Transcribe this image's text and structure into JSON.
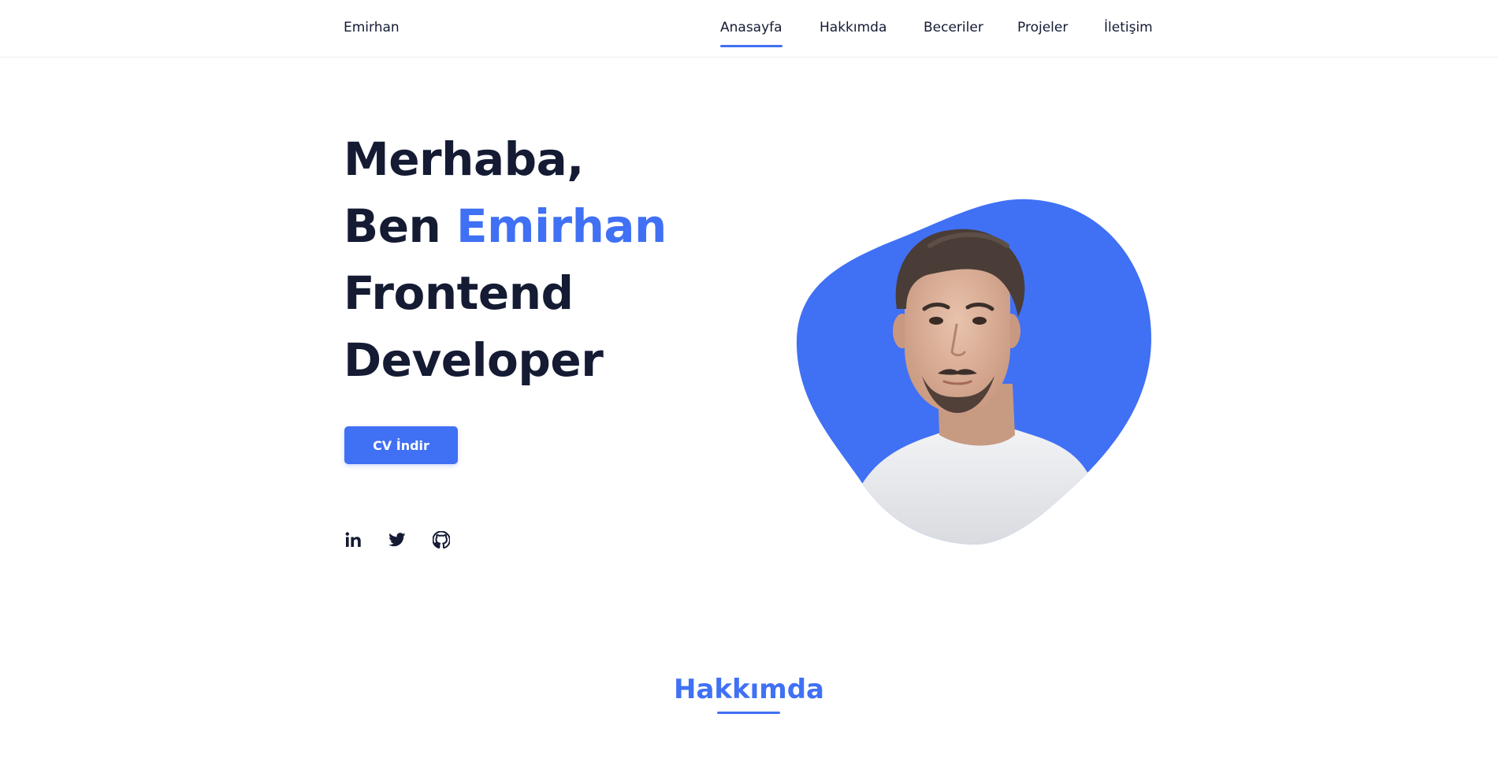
{
  "header": {
    "brand": "Emirhan",
    "nav": [
      {
        "label": "Anasayfa",
        "active": true
      },
      {
        "label": "Hakkımda",
        "active": false
      },
      {
        "label": "Beceriler",
        "active": false
      },
      {
        "label": "Projeler",
        "active": false
      },
      {
        "label": "İletişim",
        "active": false
      }
    ]
  },
  "hero": {
    "line1": "Merhaba,",
    "line2_prefix": "Ben ",
    "line2_name": "Emirhan",
    "line3": "Frontend",
    "line4": "Developer",
    "cv_button": "CV İndir",
    "socials": [
      {
        "icon": "linkedin-icon"
      },
      {
        "icon": "twitter-icon"
      },
      {
        "icon": "github-icon"
      }
    ],
    "image": "profile-photo"
  },
  "about": {
    "title": "Hakkımda"
  },
  "colors": {
    "accent": "#4070f4",
    "text": "#141b33",
    "background": "#ffffff"
  }
}
